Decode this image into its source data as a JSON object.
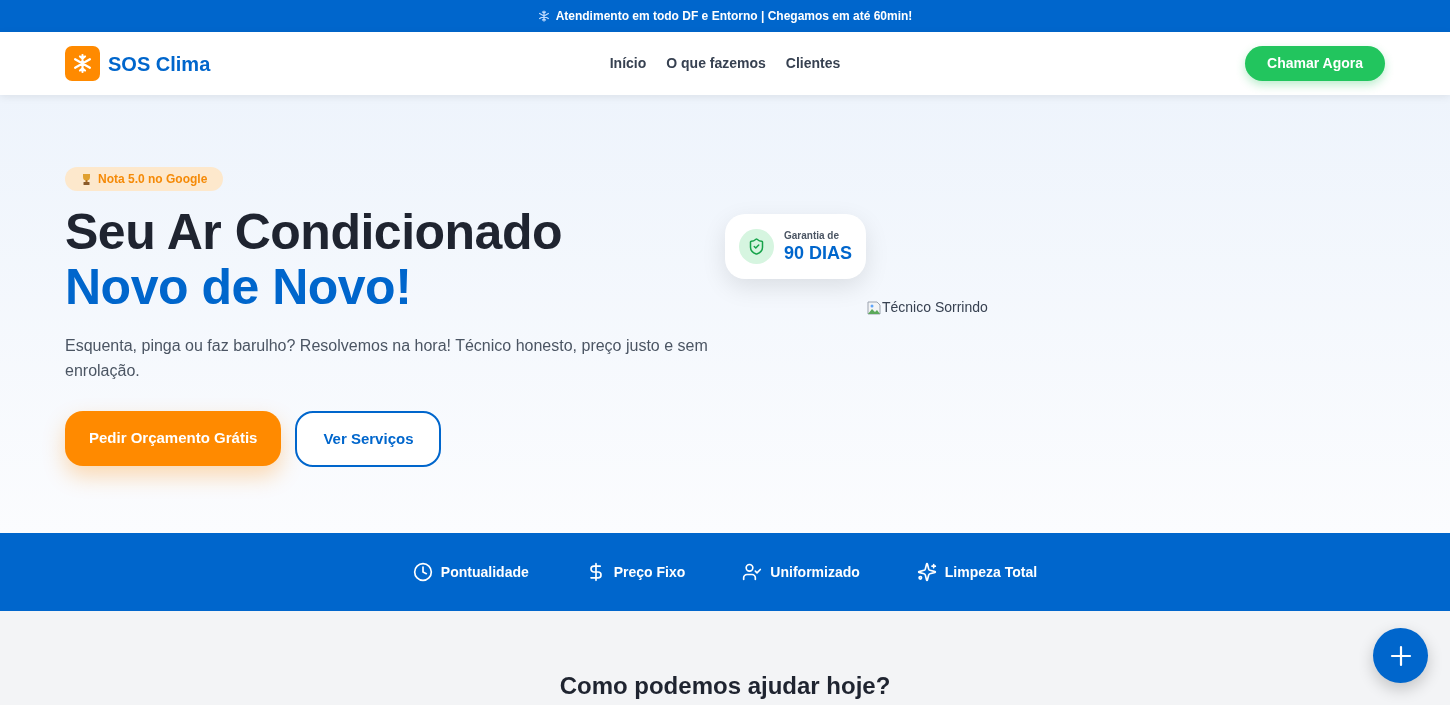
{
  "announcement_bar": {
    "text": "Atendimento em todo DF e Entorno | Chegamos em até 60min!"
  },
  "header": {
    "logo": "SOS Clima",
    "nav": [
      {
        "label": "Início"
      },
      {
        "label": "O que fazemos"
      },
      {
        "label": "Clientes"
      }
    ],
    "cta": "Chamar Agora"
  },
  "hero": {
    "badge": "Nota 5.0 no Google",
    "headline": "Seu Ar Condicionado",
    "headline_highlight": "Novo de Novo!",
    "description": "Esquenta, pinga ou faz barulho? Resolvemos na hora! Técnico honesto, preço justo e sem enrolação.",
    "buttons": [
      {
        "label": "Pedir Orçamento Grátis",
        "kind": "primary"
      },
      {
        "label": "Ver Serviços",
        "kind": "outline"
      }
    ],
    "guarantee_card": {
      "label": "Garantia de",
      "value": "90 DIAS"
    },
    "image": {
      "alt": "Técnico Sorrindo"
    }
  },
  "features": [
    {
      "label": "Pontualidade"
    },
    {
      "label": "Preço Fixo"
    },
    {
      "label": "Uniformizado"
    },
    {
      "label": "Limpeza Total"
    }
  ],
  "services_section": {
    "title": "Como podemos ajudar hoje?"
  }
}
